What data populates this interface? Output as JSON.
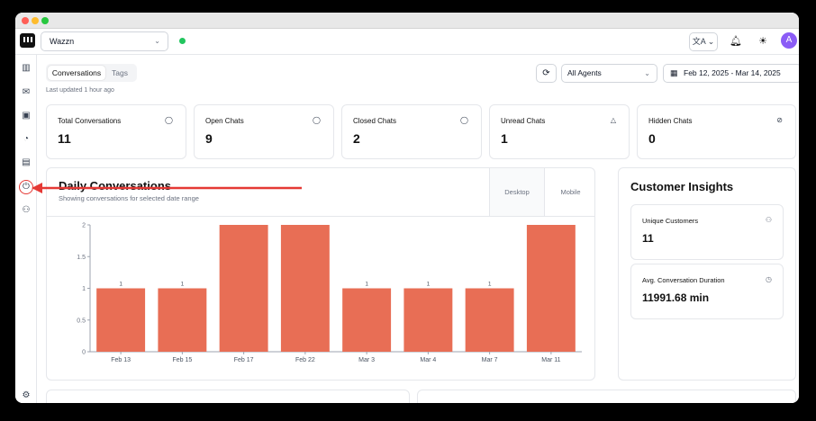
{
  "topbar": {
    "workspace": "Wazzn",
    "workspace_chevron": "⌄",
    "language_icon": "translate-icon",
    "language_label": "文A ⌄",
    "avatar_initial": "A",
    "status_color": "#22c55e"
  },
  "sidebar": {
    "items": [
      {
        "icon": "bar-chart-icon",
        "glyph": "▥"
      },
      {
        "icon": "messages-icon",
        "glyph": "✉"
      },
      {
        "icon": "inbox-icon",
        "glyph": "▣"
      },
      {
        "icon": "rss-icon",
        "glyph": "◔"
      },
      {
        "icon": "document-icon",
        "glyph": "▤"
      },
      {
        "icon": "plug-icon",
        "glyph": "⏻"
      },
      {
        "icon": "users-icon",
        "glyph": "⚇"
      }
    ],
    "settings_glyph": "⚙"
  },
  "toolbar": {
    "tabs": [
      "Conversations",
      "Tags"
    ],
    "last_updated": "Last updated 1 hour ago",
    "agents": "All Agents",
    "date_range": "Feb 12, 2025 - Mar 14, 2025"
  },
  "stats": [
    {
      "label": "Total Conversations",
      "value": "11",
      "icon": "chat-bubble-icon"
    },
    {
      "label": "Open Chats",
      "value": "9",
      "icon": "chat-bubble-icon"
    },
    {
      "label": "Closed Chats",
      "value": "2",
      "icon": "chat-bubble-icon"
    },
    {
      "label": "Unread Chats",
      "value": "1",
      "icon": "bell-icon"
    },
    {
      "label": "Hidden Chats",
      "value": "0",
      "icon": "eye-off-icon"
    }
  ],
  "daily": {
    "title": "Daily Conversations",
    "subtitle": "Showing conversations for selected date range",
    "segments": [
      "Desktop",
      "Mobile"
    ]
  },
  "chart_data": {
    "type": "bar",
    "title": "Daily Conversations",
    "categories": [
      "Feb 13",
      "Feb 15",
      "Feb 17",
      "Feb 22",
      "Mar 3",
      "Mar 4",
      "Mar 7",
      "Mar 11"
    ],
    "values": [
      1,
      1,
      2,
      2,
      1,
      1,
      1,
      2
    ],
    "data_labels": [
      "1",
      "1",
      "",
      "",
      "1",
      "1",
      "1",
      ""
    ],
    "yticks": [
      "0",
      "0.5",
      "1",
      "1.5",
      "2"
    ],
    "ylim": [
      0,
      2
    ],
    "grid": false,
    "color": "#e86e55"
  },
  "insights": {
    "title": "Customer Insights",
    "cards": [
      {
        "label": "Unique Customers",
        "value": "11",
        "icon": "users-icon"
      },
      {
        "label": "Avg. Conversation Duration",
        "value": "11991.68 min",
        "icon": "clock-icon"
      }
    ]
  },
  "colors": {
    "accent_bar": "#e86e55",
    "annotation_arrow": "#e53935",
    "avatar": "#8b5cf6"
  }
}
